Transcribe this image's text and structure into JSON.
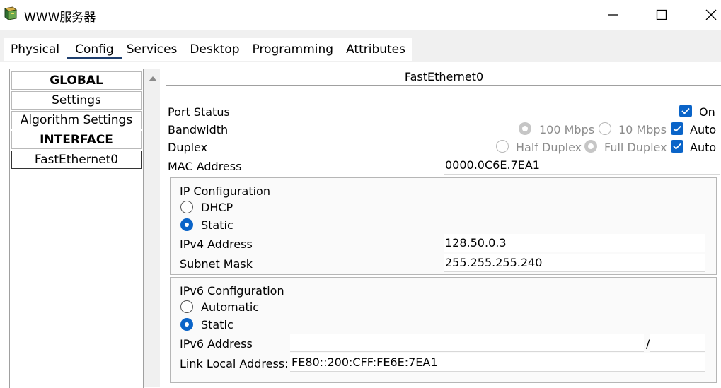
{
  "window": {
    "title": "WWW服务器"
  },
  "tabs": [
    {
      "label": "Physical"
    },
    {
      "label": "Config"
    },
    {
      "label": "Services"
    },
    {
      "label": "Desktop"
    },
    {
      "label": "Programming"
    },
    {
      "label": "Attributes"
    }
  ],
  "active_tab": "Config",
  "sidebar": {
    "items": [
      {
        "label": "GLOBAL"
      },
      {
        "label": "Settings"
      },
      {
        "label": "Algorithm Settings"
      },
      {
        "label": "INTERFACE"
      },
      {
        "label": "FastEthernet0"
      }
    ],
    "selected": "FastEthernet0"
  },
  "panel": {
    "title": "FastEthernet0",
    "port_status": {
      "label": "Port Status",
      "on_label": "On",
      "on": true
    },
    "bandwidth": {
      "label": "Bandwidth",
      "opt100": "100 Mbps",
      "opt10": "10 Mbps",
      "auto_label": "Auto",
      "auto": true
    },
    "duplex": {
      "label": "Duplex",
      "half": "Half Duplex",
      "full": "Full Duplex",
      "auto_label": "Auto",
      "auto": true
    },
    "mac": {
      "label": "MAC Address",
      "value": "0000.0C6E.7EA1"
    },
    "ipv4": {
      "title": "IP Configuration",
      "dhcp_label": "DHCP",
      "static_label": "Static",
      "mode": "Static",
      "address_label": "IPv4 Address",
      "address": "128.50.0.3",
      "mask_label": "Subnet Mask",
      "mask": "255.255.255.240"
    },
    "ipv6": {
      "title": "IPv6 Configuration",
      "auto_label": "Automatic",
      "static_label": "Static",
      "mode": "Static",
      "address_label": "IPv6 Address",
      "address": "",
      "slash": "/",
      "prefix": "",
      "link_local_label": "Link Local Address:",
      "link_local": "FE80::200:CFF:FE6E:7EA1"
    }
  },
  "colors": {
    "accent": "#0a64c8",
    "tab_underline": "#1f3f6e"
  }
}
